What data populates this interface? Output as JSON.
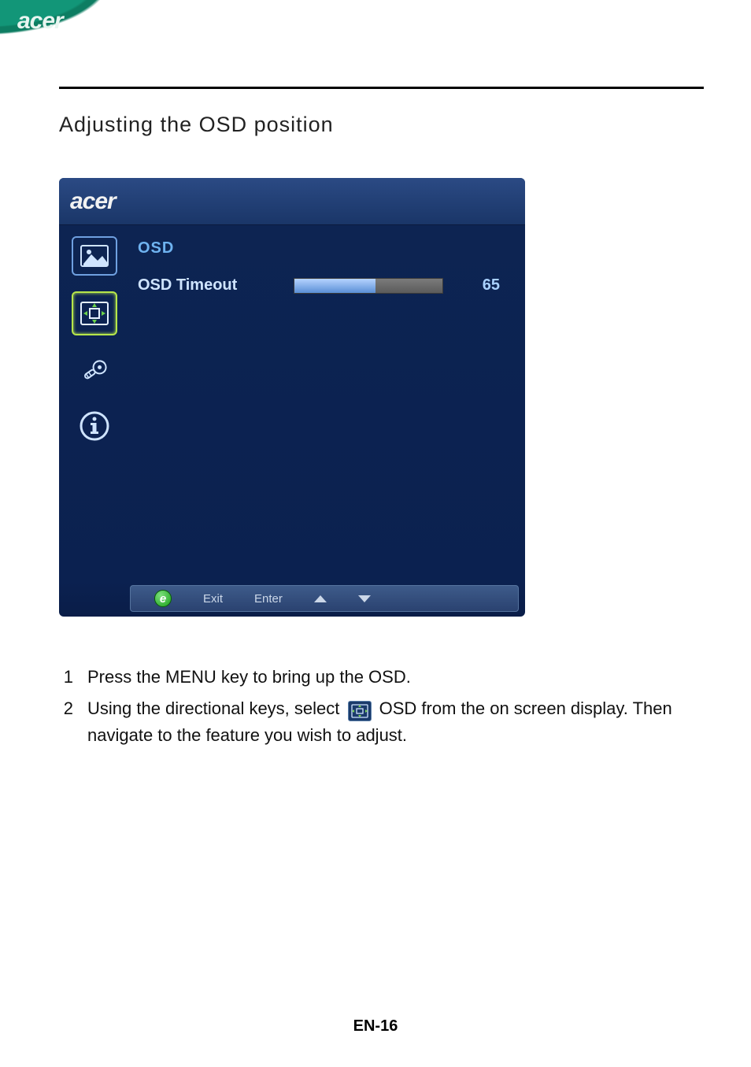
{
  "brand": "acer",
  "section_title": "Adjusting the OSD position",
  "osd": {
    "brand": "acer",
    "title": "OSD",
    "row_label": "OSD Timeout",
    "value": "65",
    "slider_percent": 55,
    "footer": {
      "exit": "Exit",
      "enter": "Enter"
    }
  },
  "steps": [
    {
      "num": "1",
      "text": "Press the MENU key to bring up the OSD."
    },
    {
      "num": "2",
      "text_before": "Using the directional keys, select ",
      "text_after": " OSD from the on screen display. Then navigate to the feature you wish to adjust."
    }
  ],
  "page_number": "EN-16"
}
